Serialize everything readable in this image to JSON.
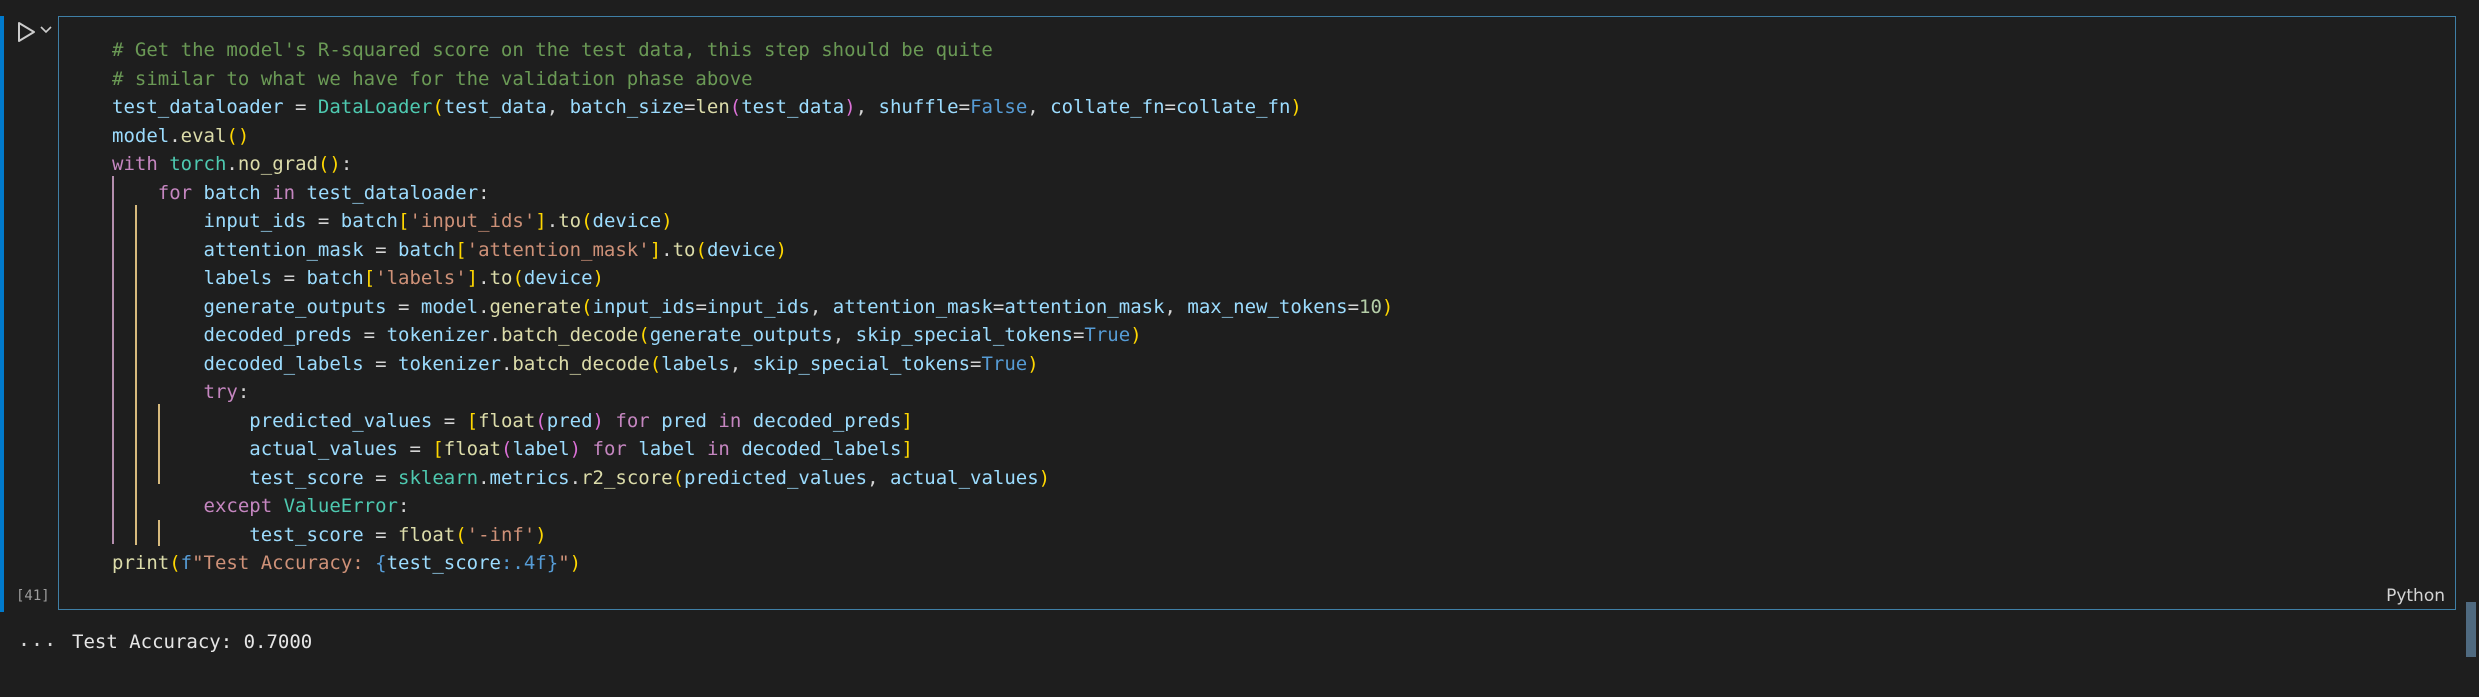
{
  "cell": {
    "execution_count": "[41]",
    "language": "Python",
    "code_lines": [
      "# Get the model's R-squared score on the test data, this step should be quite",
      "# similar to what we have for the validation phase above",
      "test_dataloader = DataLoader(test_data, batch_size=len(test_data), shuffle=False, collate_fn=collate_fn)",
      "model.eval()",
      "with torch.no_grad():",
      "    for batch in test_dataloader:",
      "        input_ids = batch['input_ids'].to(device)",
      "        attention_mask = batch['attention_mask'].to(device)",
      "        labels = batch['labels'].to(device)",
      "        generate_outputs = model.generate(input_ids=input_ids, attention_mask=attention_mask, max_new_tokens=10)",
      "        decoded_preds = tokenizer.batch_decode(generate_outputs, skip_special_tokens=True)",
      "        decoded_labels = tokenizer.batch_decode(labels, skip_special_tokens=True)",
      "        try:",
      "            predicted_values = [float(pred) for pred in decoded_preds]",
      "            actual_values = [float(label) for label in decoded_labels]",
      "            test_score = sklearn.metrics.r2_score(predicted_values, actual_values)",
      "        except ValueError:",
      "            test_score = float('-inf')",
      "print(f\"Test Accuracy: {test_score:.4f}\")"
    ]
  },
  "output": {
    "more_label": "...",
    "text": "Test Accuracy: 0.7000"
  },
  "colors": {
    "accent": "#007acc",
    "cell_border": "#3f7fa6",
    "background": "#1e1e1e"
  },
  "icons": {
    "run": "play-icon",
    "expand": "chevron-down-icon"
  }
}
